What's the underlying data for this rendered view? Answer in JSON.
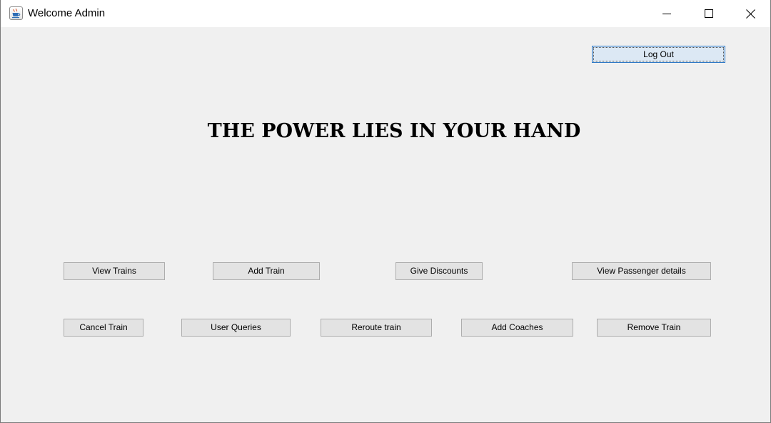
{
  "window": {
    "title": "Welcome Admin",
    "icon": "java-cup-icon",
    "controls": [
      "minimize-icon",
      "maximize-icon",
      "close-icon"
    ]
  },
  "header": {
    "logout_label": "Log Out"
  },
  "headline": "THE POWER LIES IN YOUR HAND",
  "actions": {
    "row1": [
      "View Trains",
      "Add Train",
      "Give Discounts",
      "View Passenger details"
    ],
    "row2": [
      "Cancel Train",
      "User Queries",
      "Reroute train",
      "Add Coaches",
      "Remove Train"
    ]
  },
  "colors": {
    "background": "#f0f0f0",
    "button": "#e3e3e3",
    "button_border": "#adadad",
    "focused_button": "#dce8f4",
    "focus_border": "#2f79c6"
  }
}
